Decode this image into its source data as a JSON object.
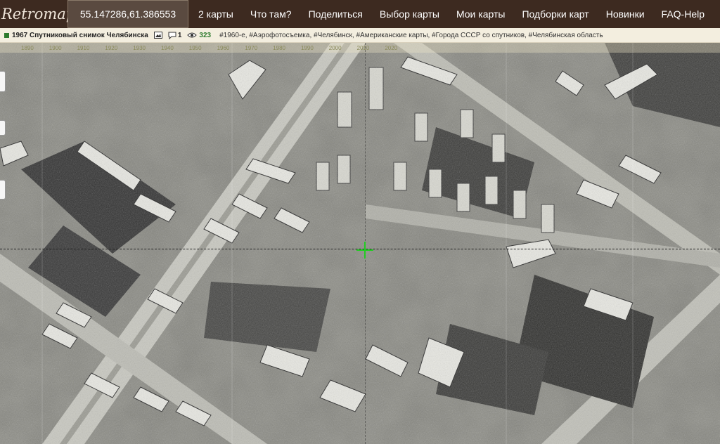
{
  "app": {
    "logo": "Retromap"
  },
  "header": {
    "coordinates": "55.147286,61.386553",
    "menu": [
      {
        "label": "2 карты"
      },
      {
        "label": "Что там?"
      },
      {
        "label": "Поделиться"
      },
      {
        "label": "Выбор карты"
      },
      {
        "label": "Мои карты"
      },
      {
        "label": "Подборки карт"
      },
      {
        "label": "Новинки"
      },
      {
        "label": "FAQ-Help"
      }
    ]
  },
  "infobar": {
    "map_title": "1967 Спутниковый снимок Челябинска",
    "comments_count": "1",
    "views_count": "323",
    "tags": "#1960-е, #Аэрофотосъемка, #Челябинск, #Американские карты, #Города СССР со спутников, #Челябинская область"
  },
  "map": {
    "timeline_years": [
      "1890",
      "1900",
      "1910",
      "1920",
      "1930",
      "1940",
      "1950",
      "1960",
      "1970",
      "1980",
      "1990",
      "2000",
      "2010",
      "2020"
    ],
    "colors": {
      "crosshair": "#22cc22",
      "status_square": "#2d7a2d",
      "header_bg": "#3d2a20"
    }
  }
}
